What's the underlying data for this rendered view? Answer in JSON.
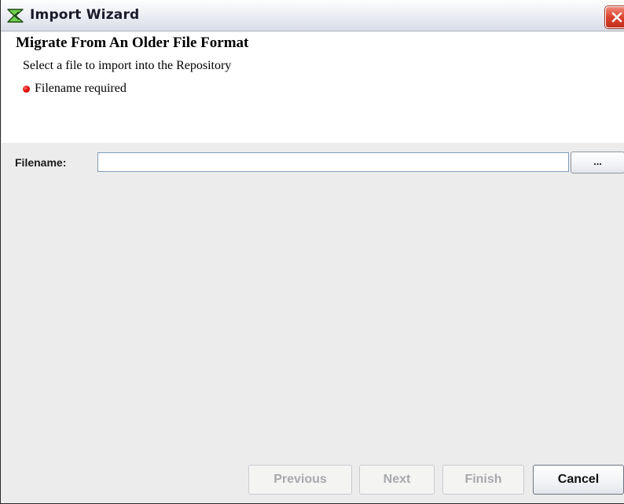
{
  "window": {
    "title": "Import Wizard",
    "icon": "wizard-app-icon",
    "close_icon": "close-icon"
  },
  "header": {
    "title": "Migrate From An Older File Format",
    "description": "Select a file to import into the Repository",
    "error_message": "Filename required",
    "error_icon": "red-dot-error-icon",
    "error_color": "#e00000"
  },
  "form": {
    "filename_label": "Filename:",
    "filename_value": "",
    "browse_label": "..."
  },
  "buttons": {
    "previous": "Previous",
    "next": "Next",
    "finish": "Finish",
    "cancel": "Cancel"
  },
  "colors": {
    "close_button": "#d9432e",
    "input_border": "#7f9db9",
    "panel_bg": "#ececec"
  }
}
